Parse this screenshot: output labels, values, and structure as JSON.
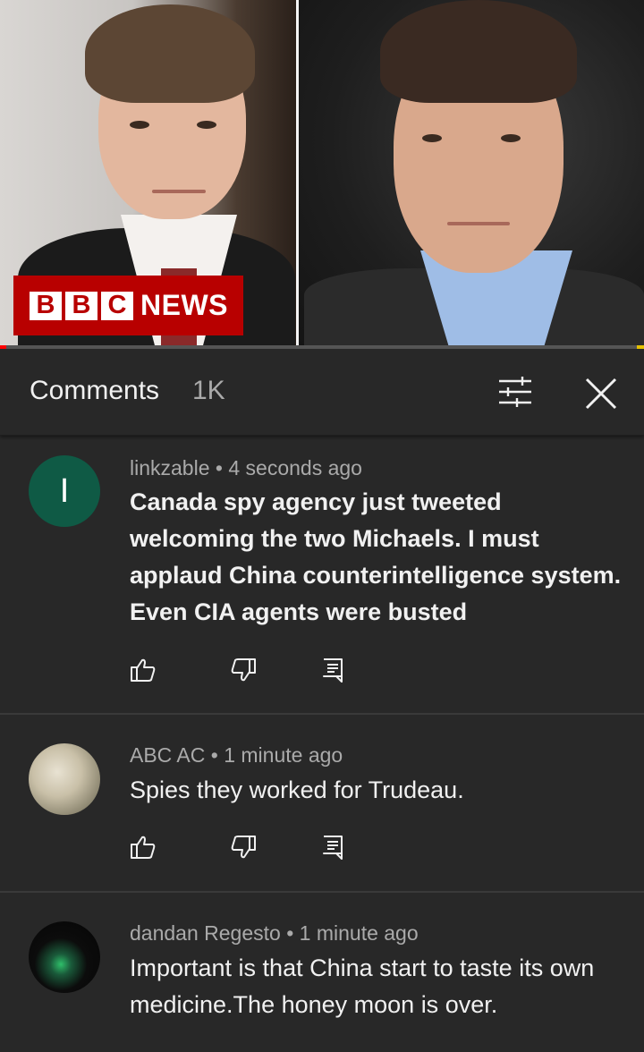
{
  "video": {
    "logo_letters": [
      "B",
      "B",
      "C"
    ],
    "logo_word": "NEWS",
    "progress_fraction": 0.01
  },
  "comments_header": {
    "title": "Comments",
    "count": "1K",
    "filter_icon": "sliders-icon",
    "close_icon": "close-icon"
  },
  "comments": [
    {
      "avatar_letter": "I",
      "author": "linkzable",
      "time": "4 seconds ago",
      "text": "Canada spy agency just tweeted welcoming the two Michaels. I must applaud China counterintelligence system. Even CIA agents were busted"
    },
    {
      "author": "ABC AC",
      "time": "1 minute ago",
      "text": "Spies they worked for Trudeau."
    },
    {
      "author": "dandan Regesto",
      "time": "1 minute ago",
      "text": "Important is that China start to taste its own medicine.The honey moon is over."
    }
  ],
  "colors": {
    "background": "#282828",
    "bbc_red": "#b80000",
    "avatar_green": "#0f5a45",
    "progress_red": "#ff0000"
  }
}
